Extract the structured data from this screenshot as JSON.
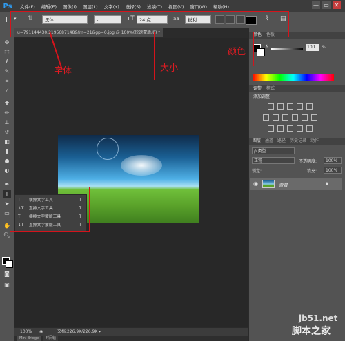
{
  "app": {
    "logo": "Ps"
  },
  "menu": [
    "文件(F)",
    "编辑(E)",
    "图像(I)",
    "图层(L)",
    "文字(Y)",
    "选择(S)",
    "滤镜(T)",
    "视图(V)",
    "窗口(W)",
    "帮助(H)"
  ],
  "window_controls": [
    "—",
    "▭",
    "✕"
  ],
  "options_bar": {
    "tool_icon": "T",
    "font_family": "黑体",
    "font_style": "-",
    "font_size": "24 点",
    "antialias_label": "aa",
    "antialias": "锐利",
    "text_color": "#000000"
  },
  "document": {
    "tab_title": "u=791144430,2195687148&fm=21&gp=0.jpg @ 100%(快速蒙版/8) *",
    "zoom": "100%",
    "doc_size": "文档:226.9K/226.9K"
  },
  "bottom_tabs": [
    "Mini Bridge",
    "时间轴"
  ],
  "tool_flyout": [
    {
      "label": "横排文字工具",
      "shortcut": "T",
      "icon": "T"
    },
    {
      "label": "直排文字工具",
      "shortcut": "T",
      "icon": "↓T"
    },
    {
      "label": "横排文字蒙版工具",
      "shortcut": "T",
      "icon": "T"
    },
    {
      "label": "直排文字蒙版工具",
      "shortcut": "T",
      "icon": "↓T"
    }
  ],
  "panels": {
    "color_tabs": [
      "颜色",
      "色板"
    ],
    "color_k_label": "K",
    "color_k_value": "100",
    "color_k_unit": "%",
    "adjust_tabs": [
      "调整",
      "样式"
    ],
    "adjust_title": "添加调整",
    "layers_tabs": [
      "图层",
      "通道",
      "路径",
      "历史记录",
      "动作"
    ],
    "layer_filter": "ρ 类型",
    "blend_mode": "正常",
    "opacity_label": "不透明度:",
    "opacity_value": "100%",
    "lock_label": "锁定:",
    "fill_label": "填充:",
    "fill_value": "100%",
    "layer_name": "背景"
  },
  "annotations": {
    "font_label": "字体",
    "size_label": "大小",
    "color_label": "颜色"
  },
  "watermark": {
    "line1": "jb51.net",
    "line2": "脚本之家"
  },
  "colors": {
    "annotation": "#d4141c",
    "ps_blue": "#2f9bf0"
  }
}
